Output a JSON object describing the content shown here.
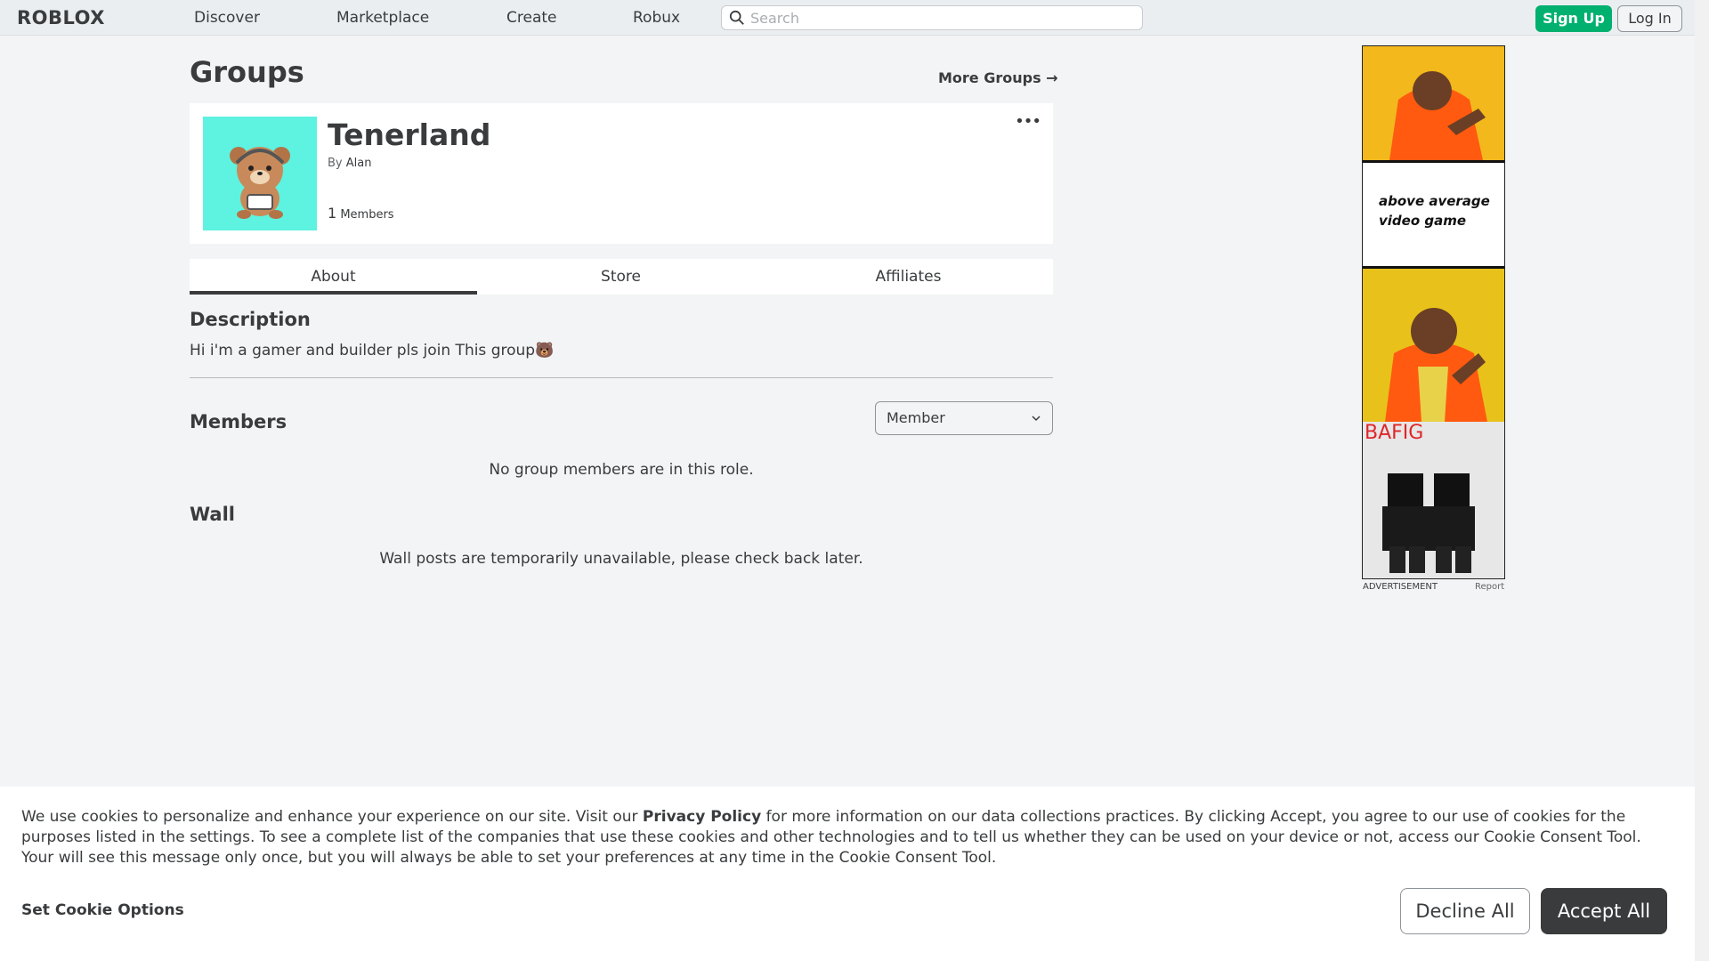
{
  "nav": {
    "logo": "ROBLOX",
    "links": [
      "Discover",
      "Marketplace",
      "Create",
      "Robux"
    ],
    "search_placeholder": "Search",
    "signup": "Sign Up",
    "login": "Log In"
  },
  "page": {
    "title": "Groups",
    "more_groups": "More Groups →"
  },
  "group": {
    "name": "Tenerland",
    "by_label": "By",
    "owner": "Alan",
    "member_count": "1",
    "members_label": "Members",
    "more_dots": "•••",
    "icon_color": "#5ef2e0"
  },
  "tabs": [
    "About",
    "Store",
    "Affiliates"
  ],
  "about": {
    "description_heading": "Description",
    "description": "Hi i'm a gamer and builder pls join This group🐻",
    "members_heading": "Members",
    "role": "Member",
    "no_members": "No group members are in this role.",
    "wall_heading": "Wall",
    "wall_msg": "Wall posts are temporarily unavailable, please check back later."
  },
  "ad": {
    "panel_text": "above average video game",
    "bafig": "BAFIG",
    "label": "ADVERTISEMENT",
    "report": "Report"
  },
  "cookie": {
    "text_before": "We use cookies to personalize and enhance your experience on our site. Visit our ",
    "privacy_link": "Privacy Policy",
    "text_after": " for more information on our data collections practices. By clicking Accept, you agree to our use of cookies for the purposes listed in the settings. To see a complete list of the companies that use these cookies and other technologies and to tell us whether they can be used on your device or not, access our Cookie Consent Tool. Your will see this message only once, but you will always be able to set your preferences at any time in the Cookie Consent Tool.",
    "options": "Set Cookie Options",
    "decline": "Decline All",
    "accept": "Accept All"
  },
  "colors": {
    "signup_green": "#00b06f",
    "accept_dark": "#393b3d"
  }
}
